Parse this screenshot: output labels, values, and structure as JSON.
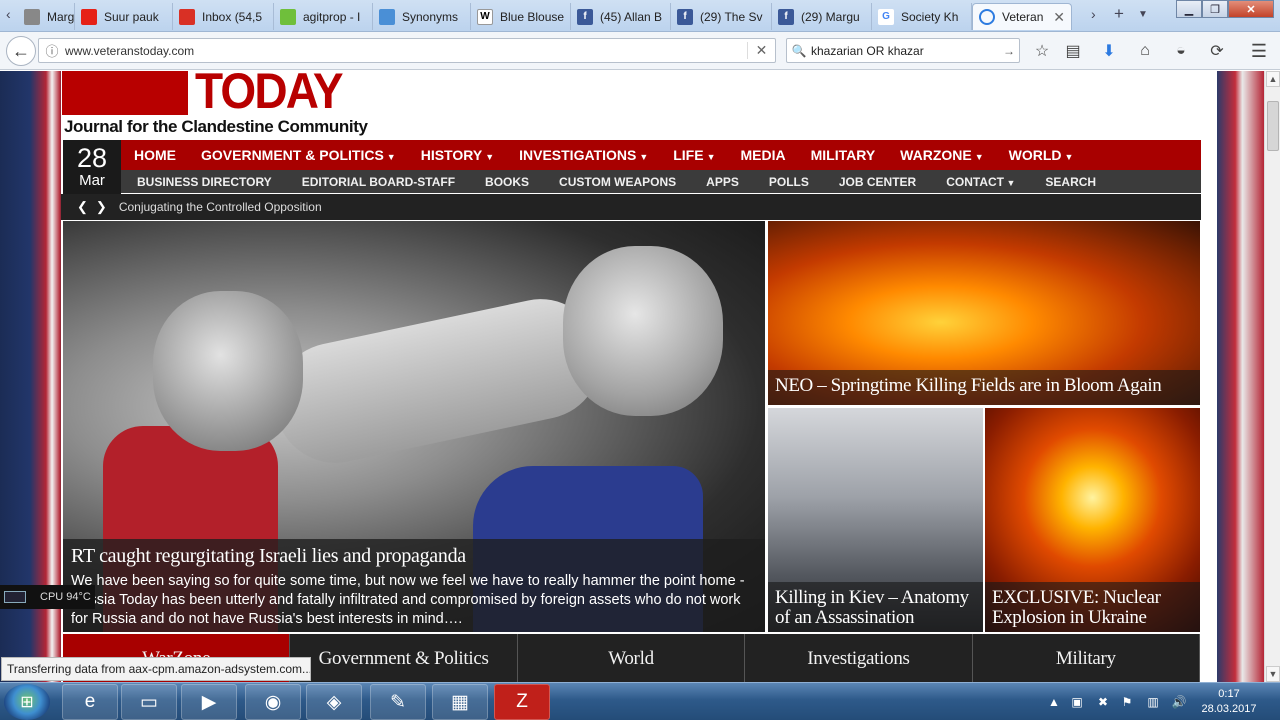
{
  "tabs": [
    {
      "label": "Marg",
      "favicon": "tab-favicon",
      "color": "#888888"
    },
    {
      "label": "Suur pauk",
      "favicon": "youtube-icon",
      "color": "#e62117"
    },
    {
      "label": "Inbox (54,5",
      "favicon": "gmail-icon",
      "color": "#d93025"
    },
    {
      "label": "agitprop - I",
      "favicon": "check-icon",
      "color": "#6fbf3b"
    },
    {
      "label": "Synonyms",
      "favicon": "synonyms-icon",
      "color": "#4a8fd6"
    },
    {
      "label": "Blue Blouse",
      "favicon": "wikipedia-icon",
      "color": "#ffffff"
    },
    {
      "label": "(45) Allan B",
      "favicon": "facebook-icon",
      "color": "#3b5998"
    },
    {
      "label": "(29) The Sv",
      "favicon": "facebook-icon",
      "color": "#3b5998"
    },
    {
      "label": "(29) Margu",
      "favicon": "facebook-icon",
      "color": "#3b5998"
    },
    {
      "label": "Society Kh",
      "favicon": "google-icon",
      "color": "#4285f4"
    },
    {
      "label": "Veteran",
      "favicon": "loading-icon",
      "color": "#2d7be0",
      "active": true
    }
  ],
  "browser": {
    "url": "www.veteranstoday.com",
    "search_value": "khazarian OR khazar"
  },
  "site": {
    "logo_text": "TODAY",
    "tagline": "Journal for the Clandestine Community",
    "date_day": "28",
    "date_month": "Mar",
    "main_nav": [
      {
        "label": "HOME",
        "dropdown": false
      },
      {
        "label": "GOVERNMENT & POLITICS",
        "dropdown": true
      },
      {
        "label": "HISTORY",
        "dropdown": true
      },
      {
        "label": "INVESTIGATIONS",
        "dropdown": true
      },
      {
        "label": "LIFE",
        "dropdown": true
      },
      {
        "label": "MEDIA",
        "dropdown": false
      },
      {
        "label": "MILITARY",
        "dropdown": false
      },
      {
        "label": "WARZONE",
        "dropdown": true
      },
      {
        "label": "WORLD",
        "dropdown": true
      }
    ],
    "sub_nav": [
      "BUSINESS DIRECTORY",
      "EDITORIAL BOARD-STAFF",
      "BOOKS",
      "CUSTOM WEAPONS",
      "APPS",
      "POLLS",
      "JOB CENTER",
      "CONTACT",
      "SEARCH"
    ],
    "ticker": "Conjugating the Controlled Opposition",
    "hero": {
      "title": "RT caught regurgitating Israeli lies and propaganda",
      "excerpt": "We have been saying so for quite some time, but now we feel we have to really hammer the point home - Russia Today has been utterly and fatally infiltrated and compromised by foreign assets who do not work for Russia and do not have Russia's best interests in mind…."
    },
    "tiles": [
      {
        "title": "NEO – Springtime Killing Fields are in Bloom Again"
      },
      {
        "title": "Killing in Kiev – Anatomy of an Assassination"
      },
      {
        "title": "EXCLUSIVE: Nuclear Explosion in Ukraine"
      }
    ],
    "categories": [
      "WarZone",
      "Government & Politics",
      "World",
      "Investigations",
      "Military"
    ]
  },
  "widgets": {
    "cpu": "CPU 94°C",
    "status": "Transferring data from aax-cpm.amazon-adsystem.com..."
  },
  "taskbar": {
    "time": "0:17",
    "date": "28.03.2017"
  },
  "colors": {
    "brand_red": "#a80000",
    "nav_dark": "#3b3b3b"
  }
}
